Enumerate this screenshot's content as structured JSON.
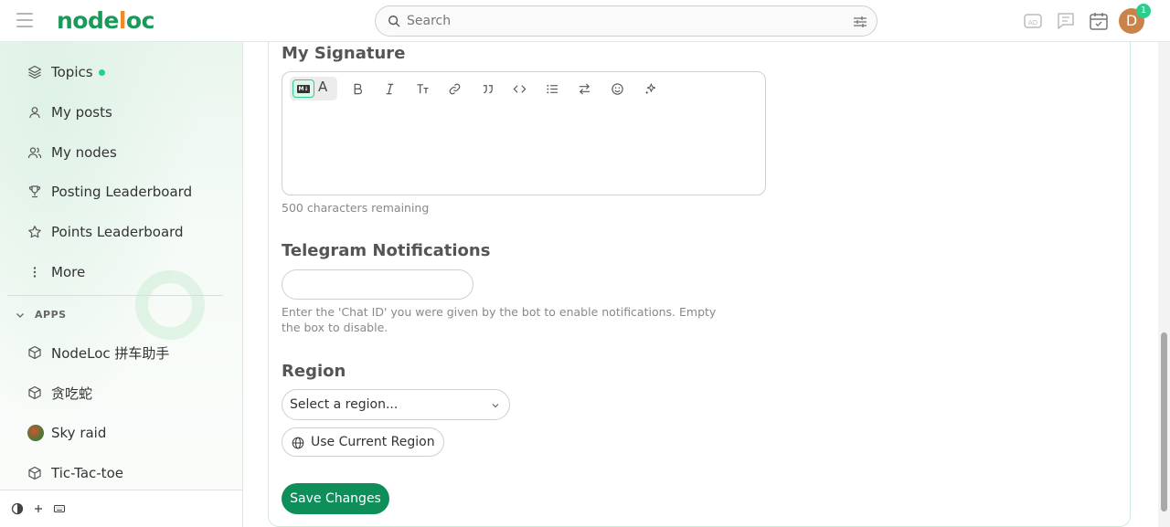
{
  "header": {
    "logo_text_a": "node",
    "logo_text_b": "l",
    "logo_text_c": "oc",
    "search_placeholder": "Search",
    "avatar_letter": "D",
    "notification_count": "1"
  },
  "sidebar": {
    "items": [
      {
        "label": "Topics",
        "icon": "layers-icon"
      },
      {
        "label": "My posts",
        "icon": "user-icon"
      },
      {
        "label": "My nodes",
        "icon": "users-icon"
      },
      {
        "label": "Posting Leaderboard",
        "icon": "trophy-icon"
      },
      {
        "label": "Points Leaderboard",
        "icon": "star-icon"
      },
      {
        "label": "More",
        "icon": "vertical-dots-icon"
      }
    ],
    "apps_heading": "APPS",
    "apps": [
      {
        "label": "NodeLoc 拼车助手",
        "icon": "cube-icon"
      },
      {
        "label": "贪吃蛇",
        "icon": "cube-icon"
      },
      {
        "label": "Sky raid",
        "icon": "app-avatar"
      },
      {
        "label": "Tic-Tac-toe",
        "icon": "cube-icon"
      }
    ]
  },
  "main": {
    "signature": {
      "heading": "My Signature",
      "remaining": "500 characters remaining"
    },
    "telegram": {
      "heading": "Telegram Notifications",
      "value": "",
      "help": "Enter the 'Chat ID' you were given by the bot to enable notifications. Empty the box to disable."
    },
    "region": {
      "heading": "Region",
      "select_value": "Select a region...",
      "use_current_label": "Use Current Region"
    },
    "save_label": "Save Changes"
  },
  "colors": {
    "brand_green": "#1a9a5a",
    "brand_orange": "#f08a24",
    "save_button": "#0e8f5a",
    "accent": "#2ccd8a"
  }
}
